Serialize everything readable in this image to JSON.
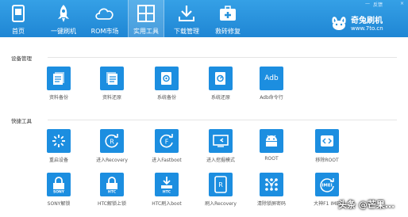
{
  "nav": [
    {
      "label": "首页",
      "icon": "phone-icon"
    },
    {
      "label": "一键刷机",
      "icon": "rocket-icon"
    },
    {
      "label": "ROM市场",
      "icon": "cloud-icon"
    },
    {
      "label": "实用工具",
      "icon": "grid-icon",
      "active": true
    },
    {
      "label": "下载管理",
      "icon": "download-icon"
    },
    {
      "label": "救砖修复",
      "icon": "medkit-icon"
    }
  ],
  "titlebar": {
    "minimize": "—",
    "feedback": "反馈",
    "close": "×"
  },
  "brand": {
    "name": "奇兔刷机",
    "url": "www.7to.cn"
  },
  "sections": {
    "device": {
      "title": "设备管理",
      "items": [
        {
          "label": "资料备份",
          "icon": "backup-data-icon"
        },
        {
          "label": "资料还原",
          "icon": "restore-data-icon"
        },
        {
          "label": "系统备份",
          "icon": "system-backup-icon"
        },
        {
          "label": "系统还原",
          "icon": "system-restore-icon"
        },
        {
          "label": "Adb命令行",
          "icon": "adb-icon",
          "glyph": "Adb"
        }
      ]
    },
    "quick": {
      "title": "快捷工具",
      "row1": [
        {
          "label": "重启设备",
          "icon": "restart-icon"
        },
        {
          "label": "进入Recovery",
          "icon": "recovery-icon",
          "glyph": "R"
        },
        {
          "label": "进入Fastboot",
          "icon": "fastboot-icon",
          "glyph": "F"
        },
        {
          "label": "进入挖掘模式",
          "icon": "mining-mode-icon"
        },
        {
          "label": "ROOT",
          "icon": "root-icon"
        },
        {
          "label": "移除ROOT",
          "icon": "remove-root-icon"
        }
      ],
      "row2": [
        {
          "label": "SONY解锁",
          "icon": "sony-unlock-icon",
          "glyph": "SONY"
        },
        {
          "label": "HTC解锁上锁",
          "icon": "htc-lock-icon",
          "glyph": "HTC"
        },
        {
          "label": "HTC刷入boot",
          "icon": "htc-boot-icon",
          "glyph": "HTC"
        },
        {
          "label": "刷入Recovery",
          "icon": "flash-recovery-icon",
          "glyph": "R"
        },
        {
          "label": "清除锁屏密码",
          "icon": "clear-lock-icon"
        },
        {
          "label": "大神F1 IMEI",
          "icon": "imei-icon",
          "glyph": "IMEI"
        }
      ]
    }
  },
  "watermark": "头条 @芒果..."
}
